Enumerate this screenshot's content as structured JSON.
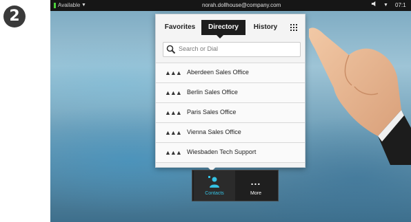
{
  "step_number": "2",
  "statusbar": {
    "presence": "Available",
    "presence_caret": "▼",
    "account_email": "norah.dollhouse@company.com",
    "volume_caret": "▼",
    "time": "07:1"
  },
  "tabs": [
    {
      "label": "Favorites"
    },
    {
      "label": "Directory"
    },
    {
      "label": "History"
    }
  ],
  "search": {
    "placeholder": "Search or Dial"
  },
  "directory": [
    {
      "label": "Aberdeen Sales Office"
    },
    {
      "label": "Berlin Sales Office"
    },
    {
      "label": "Paris Sales Office"
    },
    {
      "label": "Vienna Sales Office"
    },
    {
      "label": "Wiesbaden Tech Support"
    }
  ],
  "dock": {
    "contacts_label": "Contacts",
    "more_label": "More",
    "more_dots": "..."
  },
  "colors": {
    "accent": "#35c2e4",
    "presence_green": "#4bd13a"
  }
}
